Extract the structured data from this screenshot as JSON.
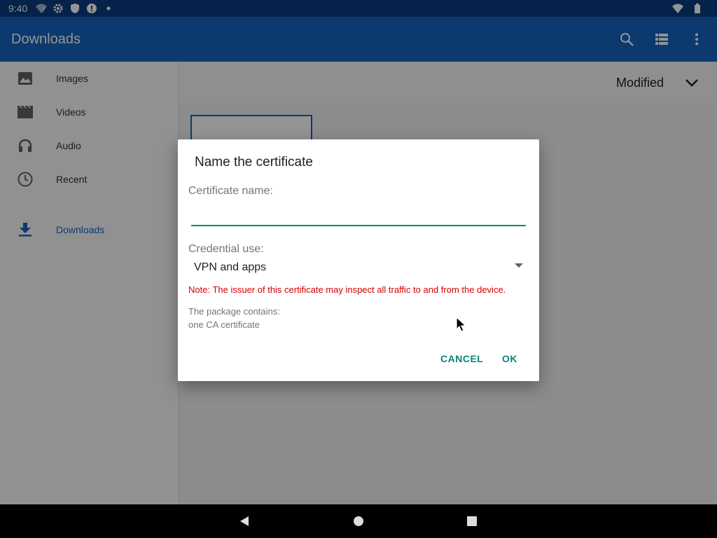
{
  "status_bar": {
    "time": "9:40",
    "icons": [
      "wifi-question-icon",
      "gear-icon",
      "shield-icon",
      "alert-icon",
      "dot-icon",
      "wifi-icon",
      "battery-icon"
    ]
  },
  "app_bar": {
    "title": "Downloads",
    "actions": [
      "search-icon",
      "list-view-icon",
      "more-vert-icon"
    ]
  },
  "sidebar": {
    "items": [
      {
        "label": "Images",
        "icon": "image-icon"
      },
      {
        "label": "Videos",
        "icon": "video-icon"
      },
      {
        "label": "Audio",
        "icon": "headphones-icon"
      },
      {
        "label": "Recent",
        "icon": "clock-icon"
      },
      {
        "label": "Downloads",
        "icon": "download-icon",
        "active": true
      }
    ]
  },
  "main": {
    "sort_label": "Modified"
  },
  "dialog": {
    "title": "Name the certificate",
    "name_label": "Certificate name:",
    "name_value": "",
    "credential_label": "Credential use:",
    "credential_value": "VPN and apps",
    "note": "Note: The issuer of this certificate may inspect all traffic to and from the device.",
    "package_label": "The package contains:",
    "package_value": "one CA certificate",
    "cancel_label": "CANCEL",
    "ok_label": "OK"
  },
  "colors": {
    "status_bar": "#0a3d80",
    "app_bar": "#1565c0",
    "accent": "#00897b",
    "warning": "#d50000"
  }
}
